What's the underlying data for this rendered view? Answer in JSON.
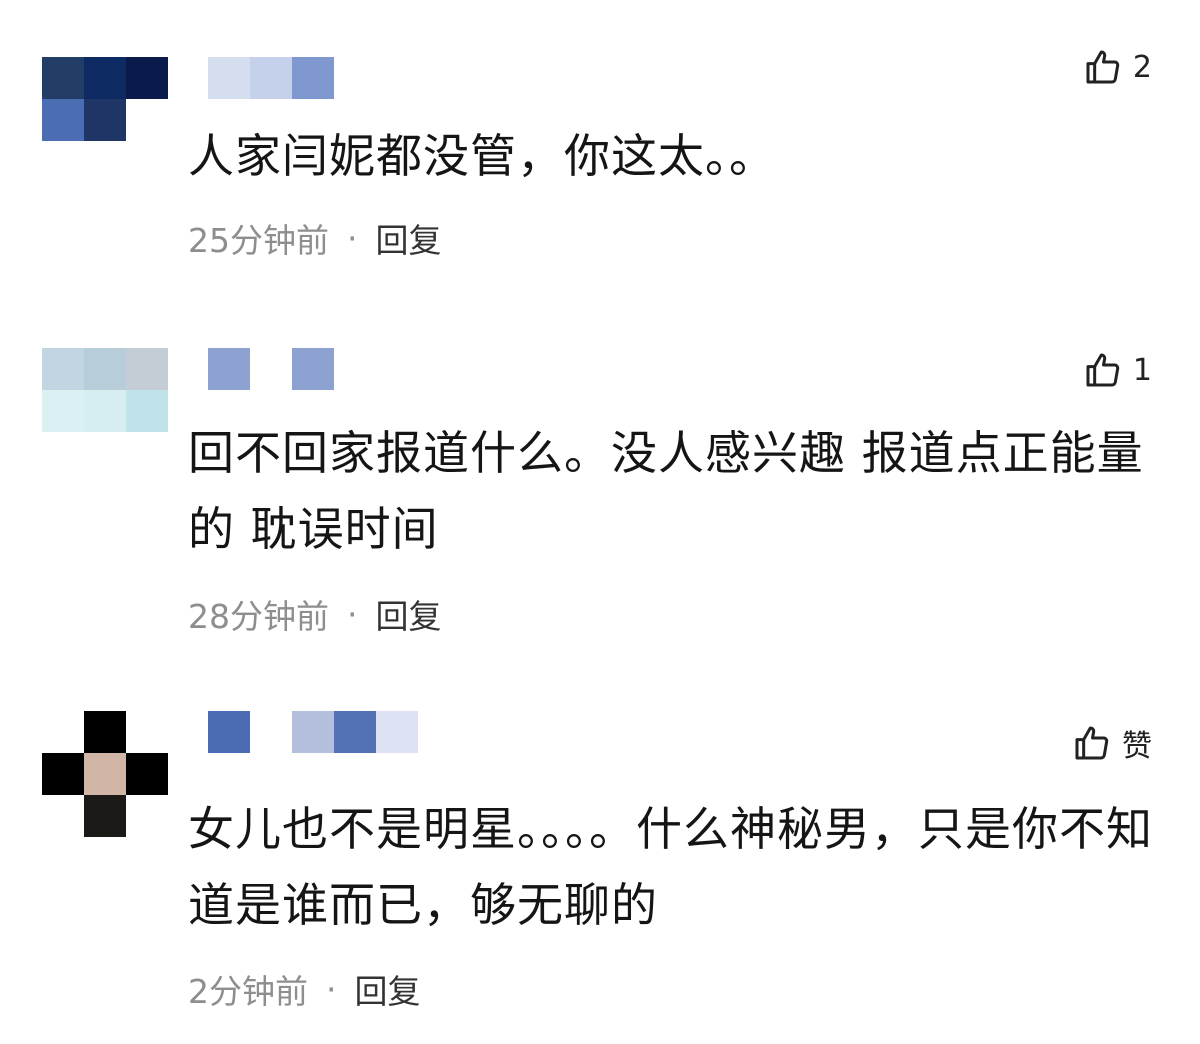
{
  "comments": [
    {
      "text": "人家闫妮都没管，你这太。。",
      "time": "25分钟前",
      "reply": "回复",
      "likes": "2",
      "avatar_colors": [
        "#223e66",
        "#0e2a63",
        "#0a1a4a",
        "#4a6db4",
        "#1f3566",
        "#ffffff"
      ],
      "name_colors": [
        "#d4deef",
        "#c5d1ea",
        "#7f98cf"
      ]
    },
    {
      "text": "回不回家报道什么。没人感兴趣 报道点正能量的 耽误时间",
      "time": "28分钟前",
      "reply": "回复",
      "likes": "1",
      "avatar_colors": [
        "#c2d5e3",
        "#b7cdd9",
        "#c4cdd5",
        "#daf0f2",
        "#d6eef0",
        "#bfe3e9"
      ],
      "name_colors": [
        "#8ea2d1",
        "#ffffff",
        "#8ea2d1"
      ]
    },
    {
      "text": "女儿也不是明星。。。。什么神秘男，只是你不知道是谁而已，够无聊的",
      "time": "2分钟前",
      "reply": "回复",
      "likes": "赞",
      "avatar_colors": [
        "#000000",
        "#d1b5a5",
        "#1c1a17"
      ],
      "name_colors": [
        "#4b6cb3",
        "#ffffff",
        "#b3bfdc",
        "#5571b5",
        "#dde3f2"
      ]
    }
  ]
}
